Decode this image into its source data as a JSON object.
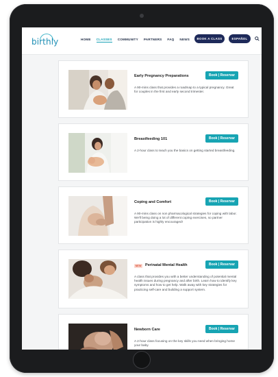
{
  "header": {
    "logo_text": "birthly",
    "nav": [
      "HOME",
      "CLASSES",
      "COMMUNITY",
      "PARTNERS",
      "FAQ",
      "NEWS"
    ],
    "active_nav": "CLASSES",
    "book_button": "BOOK A CLASS",
    "espanol_button": "ESPAÑOL",
    "search_icon": "search-icon"
  },
  "colors": {
    "accent": "#17a4b3",
    "navy": "#1e2a5a",
    "badge_bg": "#fbd7cf",
    "badge_text": "#d9543a"
  },
  "classes": [
    {
      "title": "Early Pregnancy Preparations",
      "description": "A 90-mins class that provides a roadmap to a typical pregnancy. Great for couples in the first and early second trimester.",
      "button": "Book | Reservar"
    },
    {
      "title": "Breastfeeding 101",
      "description": "A 2-hour class to teach you the basics on getting started breastfeeding.",
      "button": "Book | Reservar"
    },
    {
      "title": "Coping and Comfort",
      "description": "A 90-mins class on non pharmacological strategies for coping with labor. We'll being doing a lot of different coping exercises, so partner participation is highly encouraged!",
      "button": "Book | Reservar"
    },
    {
      "title": "Perinatal Mental Health",
      "badge": "NEW",
      "description": "A class that provides you with a better understanding of potential mental health issues during pregnancy and after birth. Learn how to identify key symptoms and how to get help. Walk away with key strategies for practicing self-care and building a support system.",
      "button": "Book | Reservar"
    },
    {
      "title": "Newborn Care",
      "description": "A 2-hour class focusing on the key skills you need when bringing home your baby.",
      "button": "Book | Reservar"
    }
  ]
}
